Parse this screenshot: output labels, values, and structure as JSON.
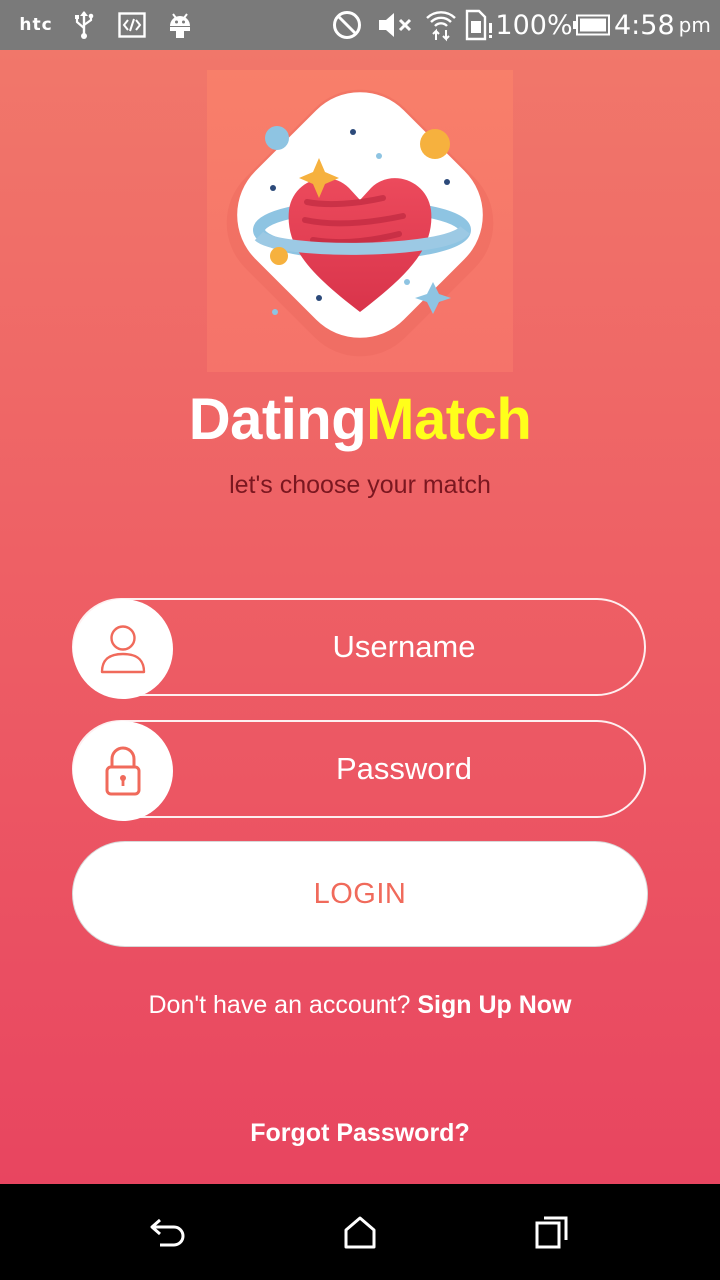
{
  "status_bar": {
    "brand": "htc",
    "battery_percent": "100%",
    "time": "4:58",
    "time_suffix": "pm",
    "icons": [
      "usb-icon",
      "developer-code-icon",
      "android-icon",
      "do-not-disturb-icon",
      "volume-muted-icon",
      "wifi-icon",
      "sim-alert-icon",
      "battery-icon"
    ]
  },
  "app": {
    "title_part1": "Dating",
    "title_part2": "Match",
    "tagline": "let's choose your match",
    "logo_icon": "heart-planet-logo-icon"
  },
  "form": {
    "username_placeholder": "Username",
    "password_placeholder": "Password",
    "username_icon": "user-icon",
    "password_icon": "lock-icon",
    "login_label": "LOGIN"
  },
  "footer": {
    "signup_prompt": "Don't have an account? ",
    "signup_link": "Sign Up Now",
    "forgot_password": "Forgot Password?"
  },
  "nav_bar": {
    "icons": [
      "back-icon",
      "home-icon",
      "recents-icon"
    ]
  },
  "colors": {
    "accent": "#f06a5b",
    "title_highlight": "#ffff1a",
    "tagline": "#7a1720",
    "status_bar": "#7a7a7a"
  }
}
